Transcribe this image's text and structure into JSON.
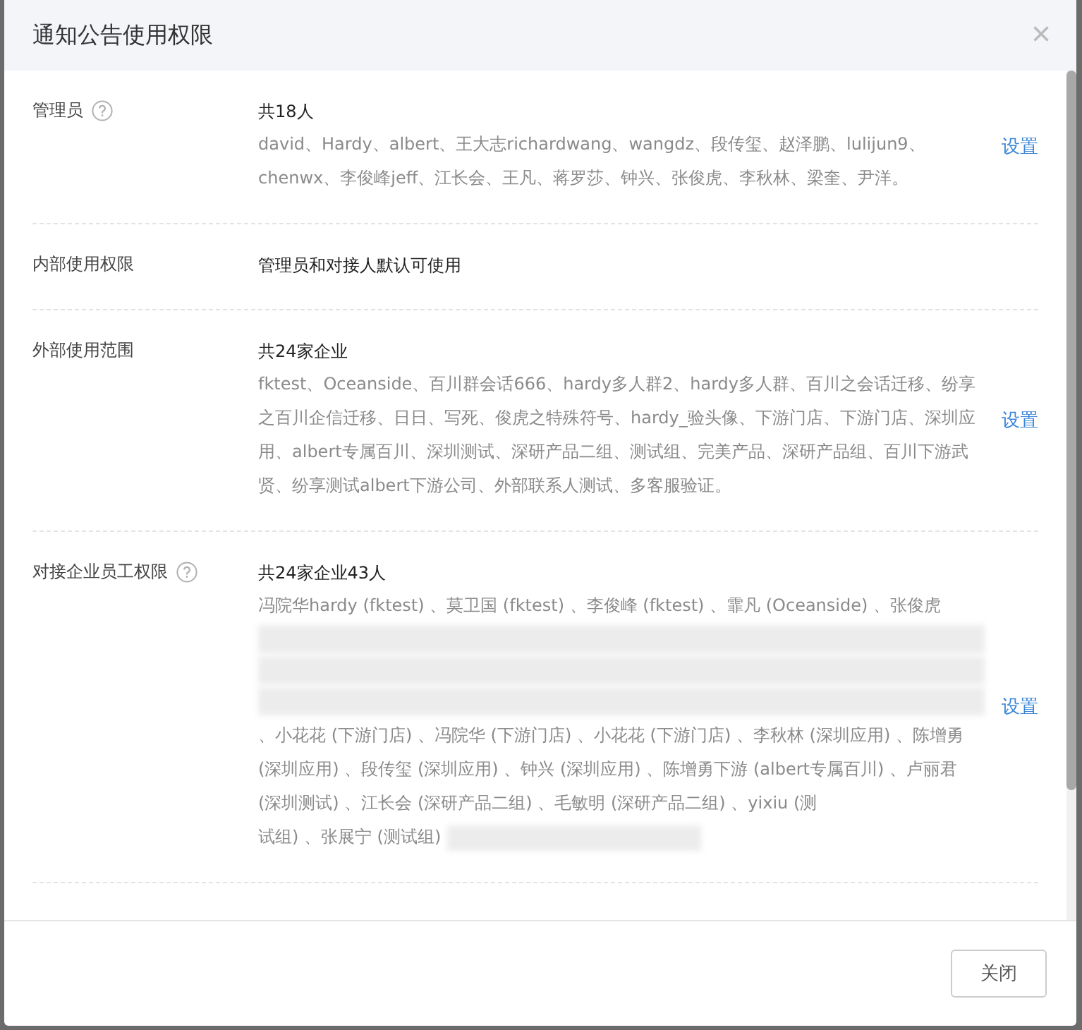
{
  "dialog": {
    "title": "通知公告使用权限",
    "close_icon": "×"
  },
  "sections": [
    {
      "label": "管理员",
      "help": true,
      "summary": "共18人",
      "parts": [
        {
          "kind": "text",
          "text": "david、Hardy、albert、王大志richardwang、wangdz、段传玺、赵泽鹏、lulijun9、chenwx、李俊峰jeff、江长会、王凡、蒋罗莎、钟兴、张俊虎、李秋林、梁奎、尹洋。"
        }
      ],
      "action": "设置"
    },
    {
      "label": "内部使用权限",
      "help": false,
      "summary": "管理员和对接人默认可使用"
    },
    {
      "label": "外部使用范围",
      "help": false,
      "summary": "共24家企业",
      "parts": [
        {
          "kind": "text",
          "text": "fktest、Oceanside、百川群会话666、hardy多人群2、hardy多人群、百川之会话迁移、纷享之百川企信迁移、日日、写死、俊虎之特殊符号、hardy_验头像、下游门店、下游门店、深圳应用、albert专属百川、深圳测试、深研产品二组、测试组、完美产品、深研产品组、百川下游武贤、纷享测试albert下游公司、外部联系人测试、多客服验证。"
        }
      ],
      "action": "设置"
    },
    {
      "label": "对接企业员工权限",
      "help": true,
      "summary": "共24家企业43人",
      "parts": [
        {
          "kind": "text",
          "text": "冯院华hardy (fktest) 、莫卫国 (fktest) 、李俊峰 (fktest) 、霏凡 (Oceanside) 、张俊虎"
        },
        {
          "kind": "blur-line"
        },
        {
          "kind": "blur-line"
        },
        {
          "kind": "blur-line"
        },
        {
          "kind": "text",
          "text": "、小花花 (下游门店) 、冯院华 (下游门店) 、小花花 (下游门店) 、李秋林 (深圳应用) 、陈增勇 (深圳应用) 、段传玺 (深圳应用) 、钟兴 (深圳应用) 、陈增勇下游 (albert专属百川) 、卢丽君 (深圳测试) 、江长会 (深研产品二组) 、毛敏明 (深研产品二组) 、yixiu (测"
        },
        {
          "kind": "text-inline",
          "text": "试组) 、张展宁 (测试组)"
        },
        {
          "kind": "blur-inline"
        }
      ],
      "action": "设置"
    }
  ],
  "footer": {
    "button": "关闭"
  }
}
